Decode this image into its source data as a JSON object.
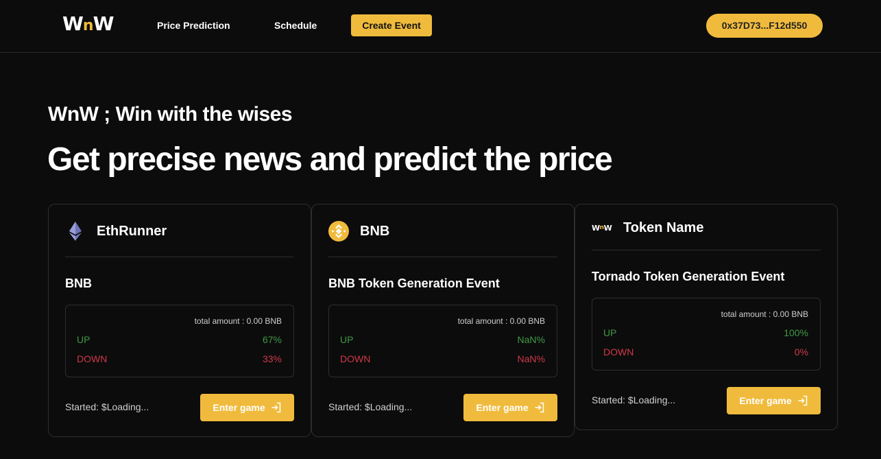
{
  "nav": {
    "logo": {
      "w1": "W",
      "n": "n",
      "w2": "W"
    },
    "links": [
      "Price Prediction",
      "Schedule"
    ],
    "create_event": "Create Event",
    "wallet": "0x37D73...F12d550"
  },
  "hero": {
    "tagline": "WnW ; Win with the wises",
    "headline": "Get precise news and predict the price"
  },
  "colors": {
    "accent": "#f0bb3c",
    "up": "#3f9a47",
    "down": "#d0384a",
    "background": "#0c0c0c"
  },
  "cards": [
    {
      "icon": "ethereum-icon",
      "token_name": "EthRunner",
      "event_title": "BNB",
      "total_amount": "total amount : 0.00 BNB",
      "up_label": "UP",
      "up_value": "67%",
      "down_label": "DOWN",
      "down_value": "33%",
      "started": "Started: $Loading...",
      "enter": "Enter game"
    },
    {
      "icon": "bnb-icon",
      "token_name": "BNB",
      "event_title": "BNB Token Generation Event",
      "total_amount": "total amount : 0.00 BNB",
      "up_label": "UP",
      "up_value": "NaN%",
      "down_label": "DOWN",
      "down_value": "NaN%",
      "started": "Started: $Loading...",
      "enter": "Enter game"
    },
    {
      "icon": "wnw-logo-icon",
      "icon_text": {
        "w1": "W",
        "n": "n",
        "w2": "W"
      },
      "token_name": "Token Name",
      "event_title": "Tornado Token Generation Event",
      "total_amount": "total amount : 0.00 BNB",
      "up_label": "UP",
      "up_value": "100%",
      "down_label": "DOWN",
      "down_value": "0%",
      "started": "Started: $Loading...",
      "enter": "Enter game"
    }
  ]
}
